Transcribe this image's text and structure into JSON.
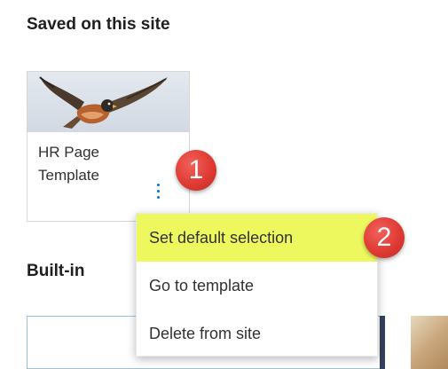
{
  "sections": {
    "saved_heading": "Saved on this site",
    "builtin_heading": "Built-in"
  },
  "template_card": {
    "title": "HR Page Template",
    "thumbnail_icon": "bird-icon",
    "more_icon": "more-vertical-icon"
  },
  "context_menu": {
    "items": [
      {
        "label": "Set default selection",
        "highlighted": true
      },
      {
        "label": "Go to template",
        "highlighted": false
      },
      {
        "label": "Delete from site",
        "highlighted": false
      }
    ]
  },
  "callouts": {
    "first": "1",
    "second": "2"
  },
  "colors": {
    "highlight": "#ecf85e",
    "callout": "#de3b34",
    "accent": "#0078d4"
  }
}
